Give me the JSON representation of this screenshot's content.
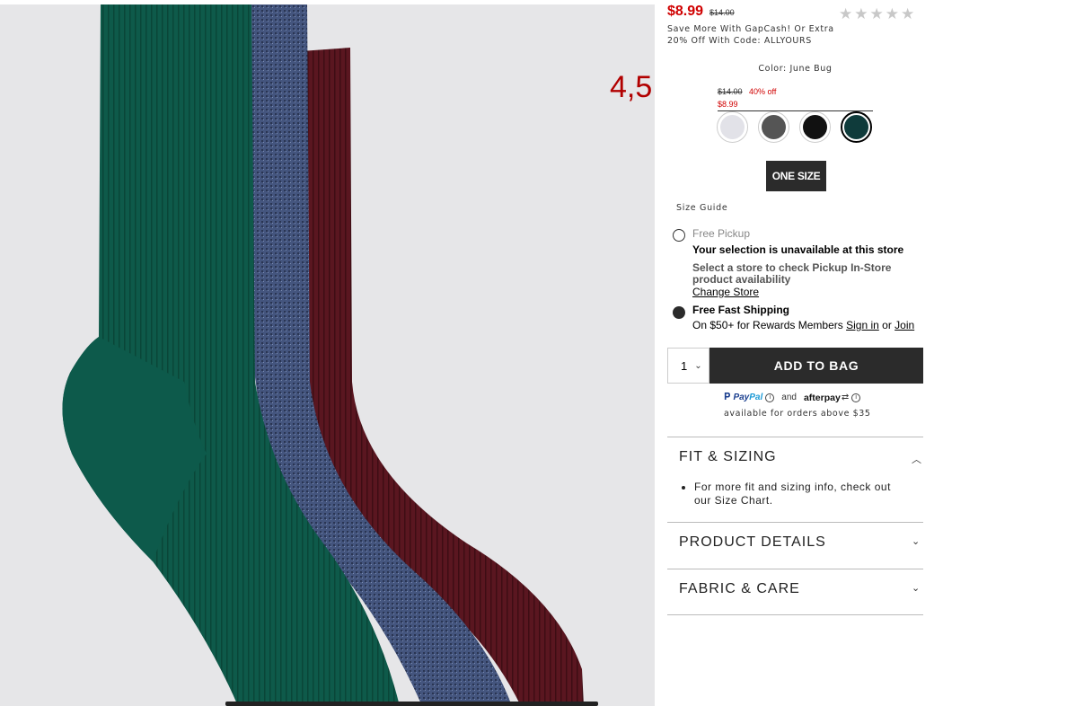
{
  "product": {
    "sale_price": "$8.99",
    "original_price": "$14.00",
    "rating_overlay": "4,5",
    "stars": [
      "★",
      "★",
      "★",
      "★",
      "★"
    ],
    "promo_line1": "Save More With GapCash! Or Extra",
    "promo_line2": "20% Off With Code: ALLYOURS"
  },
  "color": {
    "label": "Color: June Bug",
    "swatch_original": "$14.00",
    "swatch_discount": "40% off",
    "swatch_sale": "$8.99",
    "swatches": [
      {
        "name": "light-gray",
        "color": "#e2e2e8"
      },
      {
        "name": "charcoal",
        "color": "#555555"
      },
      {
        "name": "black",
        "color": "#111111"
      },
      {
        "name": "june-bug",
        "color": "#0f3b3b",
        "selected": true
      }
    ]
  },
  "size": {
    "option": "ONE SIZE",
    "guide": "Size Guide"
  },
  "fulfillment": {
    "pickup_title": "Free Pickup",
    "pickup_unavailable": "Your selection is unavailable at this store",
    "pickup_hint_line1": "Select a store to check Pickup In-Store",
    "pickup_hint_line2": "product availability",
    "change_store": "Change Store",
    "shipping_title": "Free Fast Shipping",
    "shipping_prefix": "On $50+ for Rewards Members",
    "sign_in": "Sign in",
    "or": "or",
    "join": "Join"
  },
  "cart": {
    "quantity": "1",
    "add_to_bag": "ADD TO BAG"
  },
  "payments": {
    "paypal_pay": "Pay",
    "paypal_pal": "Pal",
    "and": "and",
    "afterpay": "afterpay",
    "note": "available for orders above $35"
  },
  "accordion": {
    "fit_title": "FIT & SIZING",
    "fit_bullet_line1": "For more fit and sizing info, check out",
    "fit_bullet_line2": "our Size Chart.",
    "details_title": "PRODUCT DETAILS",
    "fabric_title": "FABRIC & CARE"
  }
}
